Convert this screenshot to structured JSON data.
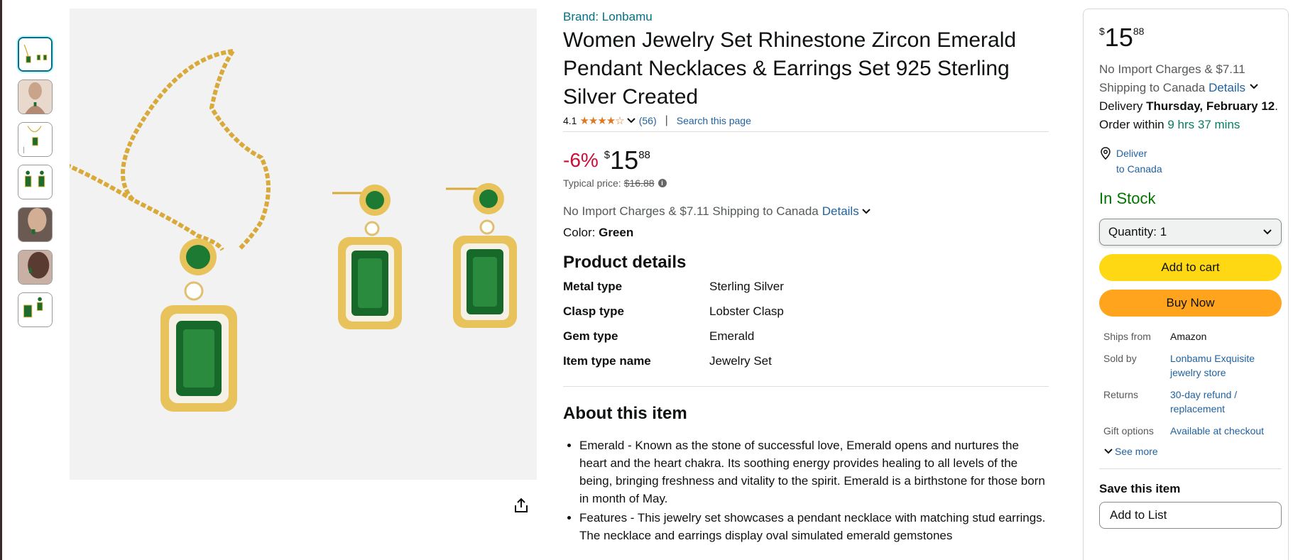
{
  "gallery": {
    "thumbnails": [
      "thumb-1",
      "thumb-2",
      "thumb-3",
      "thumb-4",
      "thumb-5",
      "thumb-6",
      "thumb-7"
    ]
  },
  "product": {
    "brand": "Brand: Lonbamu",
    "title": "Women Jewelry Set Rhinestone Zircon Emerald Pendant Necklaces & Earrings Set 925 Sterling Silver Created",
    "rating": "4.1",
    "stars": "★★★★☆",
    "review_count": "(56)",
    "search_page": "Search this page",
    "discount": "-6%",
    "currency": "$",
    "price_whole": "15",
    "price_fraction": "88",
    "typical_label": "Typical price:",
    "typical_price": "$16.88",
    "import_text": "No Import Charges & $7.11 Shipping to Canada",
    "details_link": "Details",
    "color_label": "Color:",
    "color_value": "Green"
  },
  "details": {
    "title": "Product details",
    "rows": [
      {
        "key": "Metal type",
        "value": "Sterling Silver"
      },
      {
        "key": "Clasp type",
        "value": "Lobster Clasp"
      },
      {
        "key": "Gem type",
        "value": "Emerald"
      },
      {
        "key": "Item type name",
        "value": "Jewelry Set"
      }
    ]
  },
  "about": {
    "title": "About this item",
    "bullets": [
      "Emerald - Known as the stone of successful love, Emerald opens and nurtures the heart and the heart chakra. Its soothing energy provides healing to all levels of the being, bringing freshness and vitality to the spirit. Emerald is a birthstone for those born in month of May.",
      "Features - This jewelry set showcases a pendant necklace with matching stud earrings. The necklace and earrings display oval simulated emerald gemstones"
    ]
  },
  "buybox": {
    "currency": "$",
    "price_whole": "15",
    "price_fraction": "88",
    "import_text": "No Import Charges & $7.11 Shipping to Canada",
    "details_link": "Details",
    "delivery_prefix": "Delivery",
    "delivery_date": "Thursday, February 12",
    "order_within_prefix": "Order within",
    "order_within_time": "9 hrs 37 mins",
    "deliver_to_line1": "Deliver",
    "deliver_to_line2": "to Canada",
    "stock": "In Stock",
    "quantity_label": "Quantity:",
    "quantity_value": "1",
    "add_to_cart": "Add to cart",
    "buy_now": "Buy Now",
    "ships_from_label": "Ships from",
    "ships_from_value": "Amazon",
    "sold_by_label": "Sold by",
    "sold_by_value": "Lonbamu Exquisite jewelry store",
    "returns_label": "Returns",
    "returns_value": "30-day refund / replacement",
    "gift_label": "Gift options",
    "gift_value": "Available at checkout",
    "see_more": "See more",
    "save_title": "Save this item",
    "add_to_list": "Add to List"
  },
  "colors": {
    "link": "#2162a1",
    "discount": "#cc0c39",
    "in_stock": "#007600",
    "add_to_cart": "#ffd814",
    "buy_now": "#ffa41c"
  }
}
